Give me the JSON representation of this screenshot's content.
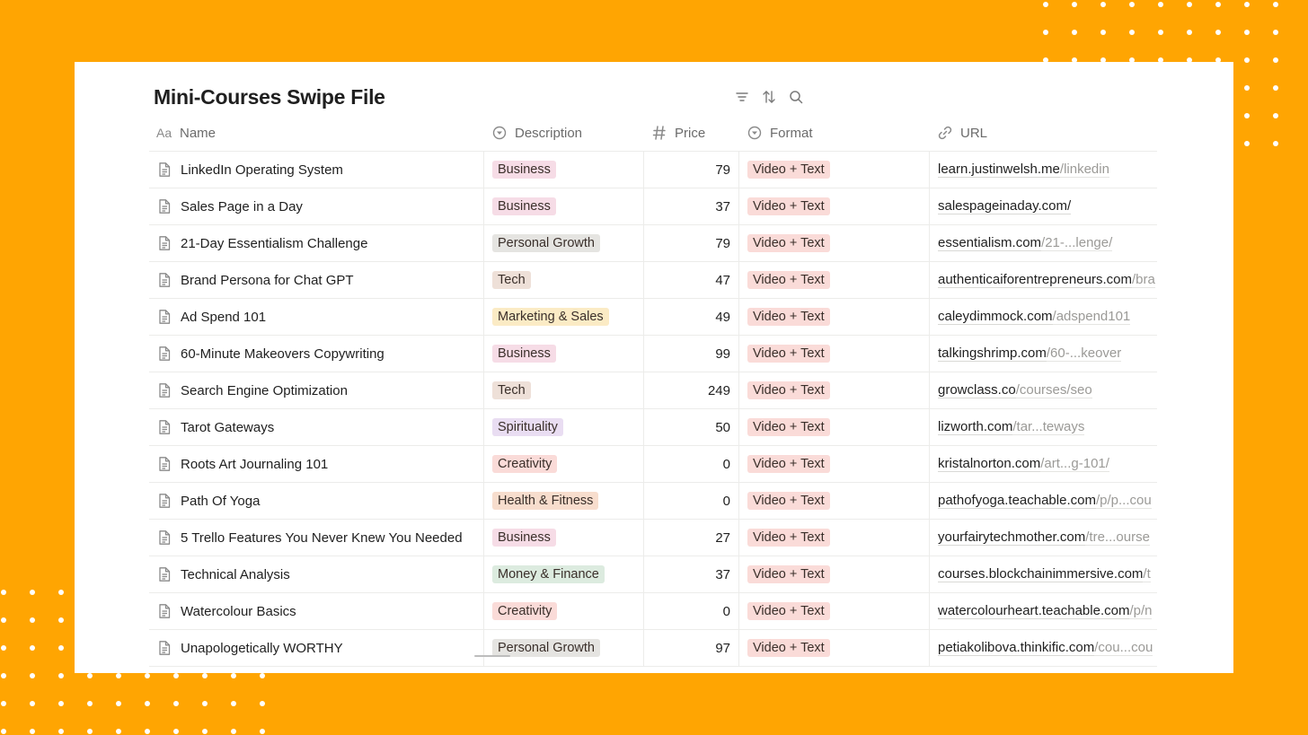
{
  "page": {
    "title": "Mini-Courses Swipe File",
    "colors": {
      "background": "#FFA502",
      "panel": "#ffffff"
    }
  },
  "toolbar": {
    "icons": [
      "filter-icon",
      "sort-icon",
      "search-icon"
    ]
  },
  "columns": [
    {
      "label": "Name",
      "icon": "text-type-icon"
    },
    {
      "label": "Description",
      "icon": "select-icon"
    },
    {
      "label": "Price",
      "icon": "number-icon"
    },
    {
      "label": "Format",
      "icon": "select-icon"
    },
    {
      "label": "URL",
      "icon": "link-icon"
    }
  ],
  "tag_colors": {
    "Business": "#F6DCE6",
    "Personal Growth": "#E5E4E1",
    "Tech": "#EEE0D8",
    "Marketing & Sales": "#FBEBC5",
    "Spirituality": "#E9DDF2",
    "Creativity": "#FADBD8",
    "Health & Fitness": "#F7DDCD",
    "Money & Finance": "#DCEBDF",
    "Video + Text": "#FADBD8"
  },
  "rows": [
    {
      "name": "LinkedIn Operating System",
      "description": "Business",
      "price": "79",
      "format": "Video + Text",
      "url_domain": "learn.justinwelsh.me",
      "url_path": "/linkedin"
    },
    {
      "name": "Sales Page in a Day",
      "description": "Business",
      "price": "37",
      "format": "Video + Text",
      "url_domain": "salespageinaday.com/",
      "url_path": ""
    },
    {
      "name": "21-Day Essentialism Challenge",
      "description": "Personal Growth",
      "price": "79",
      "format": "Video + Text",
      "url_domain": "essentialism.com",
      "url_path": "/21-...lenge/"
    },
    {
      "name": "Brand Persona for Chat GPT",
      "description": "Tech",
      "price": "47",
      "format": "Video + Text",
      "url_domain": "authenticaiforentrepreneurs.com",
      "url_path": "/bra"
    },
    {
      "name": "Ad Spend 101",
      "description": "Marketing & Sales",
      "price": "49",
      "format": "Video + Text",
      "url_domain": "caleydimmock.com",
      "url_path": "/adspend101"
    },
    {
      "name": "60-Minute Makeovers Copywriting",
      "description": "Business",
      "price": "99",
      "format": "Video + Text",
      "url_domain": "talkingshrimp.com",
      "url_path": "/60-...keover"
    },
    {
      "name": "Search Engine Optimization",
      "description": "Tech",
      "price": "249",
      "format": "Video + Text",
      "url_domain": "growclass.co",
      "url_path": "/courses/seo"
    },
    {
      "name": "Tarot Gateways",
      "description": "Spirituality",
      "price": "50",
      "format": "Video + Text",
      "url_domain": "lizworth.com",
      "url_path": "/tar...teways"
    },
    {
      "name": "Roots Art Journaling 101",
      "description": "Creativity",
      "price": "0",
      "format": "Video + Text",
      "url_domain": "kristalnorton.com",
      "url_path": "/art...g-101/"
    },
    {
      "name": "Path Of Yoga",
      "description": "Health & Fitness",
      "price": "0",
      "format": "Video + Text",
      "url_domain": "pathofyoga.teachable.com",
      "url_path": "/p/p...cou"
    },
    {
      "name": "5 Trello Features You Never Knew You Needed",
      "description": "Business",
      "price": "27",
      "format": "Video + Text",
      "url_domain": "yourfairytechmother.com",
      "url_path": "/tre...ourse"
    },
    {
      "name": "Technical Analysis",
      "description": "Money & Finance",
      "price": "37",
      "format": "Video + Text",
      "url_domain": "courses.blockchainimmersive.com",
      "url_path": "/t"
    },
    {
      "name": "Watercolour Basics",
      "description": "Creativity",
      "price": "0",
      "format": "Video + Text",
      "url_domain": "watercolourheart.teachable.com",
      "url_path": "/p/n"
    },
    {
      "name": "Unapologetically WORTHY",
      "description": "Personal Growth",
      "price": "97",
      "format": "Video + Text",
      "url_domain": "petiakolibova.thinkific.com",
      "url_path": "/cou...cou"
    }
  ]
}
